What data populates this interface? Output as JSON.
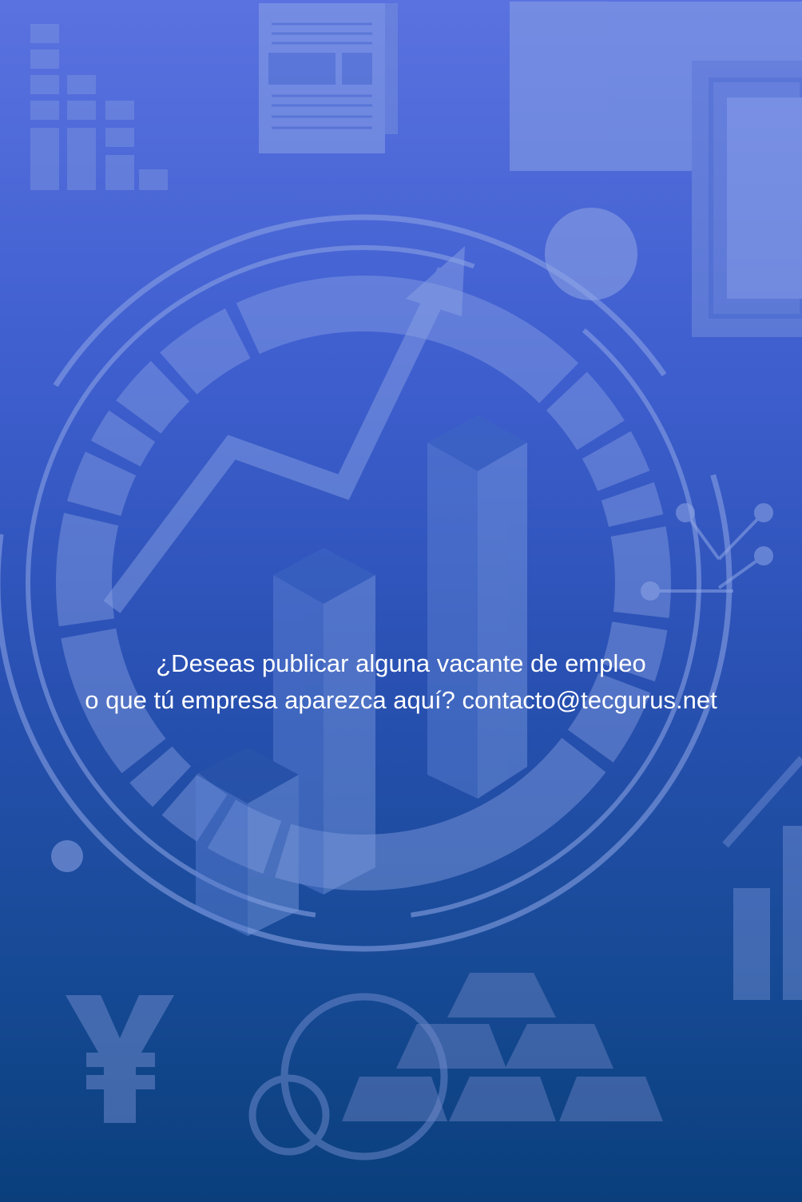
{
  "message": {
    "line1": "¿Deseas publicar alguna vacante de empleo",
    "line2": "o que tú empresa aparezca aquí? contacto@tecgurus.net"
  },
  "colors": {
    "background_top": "#5a72e0",
    "background_bottom": "#0a3f7c",
    "decor": "#8fa6e6",
    "text": "#ffffff"
  },
  "icons": [
    "bar-chart-icon",
    "document-icon",
    "picture-frame-icon",
    "dial-gauge-icon",
    "trend-arrow-icon",
    "3d-bar-chart-icon",
    "network-nodes-icon",
    "yen-icon",
    "gold-bars-icon",
    "coin-icon"
  ]
}
